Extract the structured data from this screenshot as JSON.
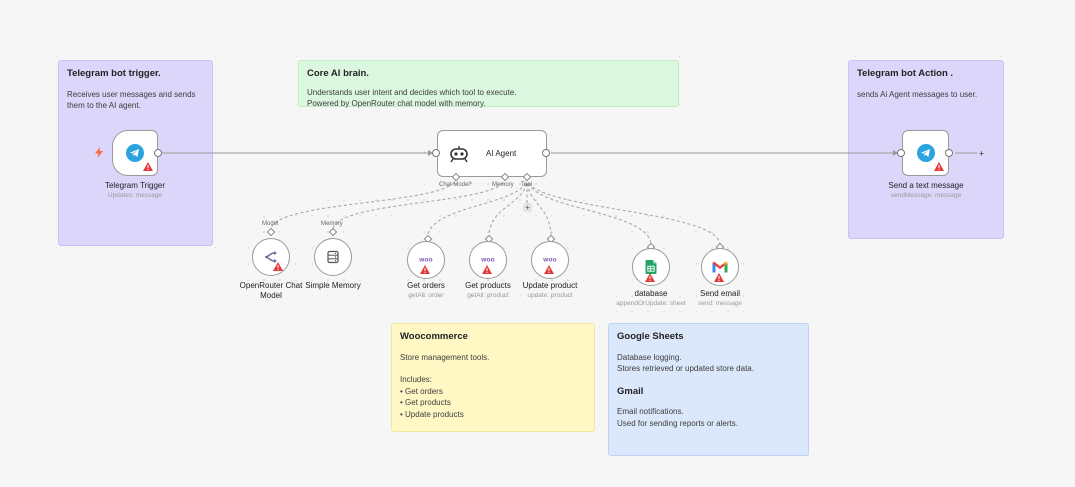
{
  "sticky_notes": {
    "telegram_trigger": {
      "title": "Telegram bot trigger.",
      "body": "Receives user messages and sends them to the AI agent."
    },
    "core_ai": {
      "title": "Core AI brain.",
      "line1": "Understands user intent and decides which tool to execute.",
      "line2": "Powered by OpenRouter chat model with memory."
    },
    "telegram_action": {
      "title": "Telegram bot Action .",
      "body": "sends Ai Agent messages to user."
    },
    "woocommerce": {
      "title": "Woocommerce",
      "line1": "Store management tools.",
      "line2": "Includes:",
      "items": [
        "• Get orders",
        "• Get products",
        "• Update products"
      ]
    },
    "google_sheets": {
      "title": "Google Sheets",
      "line1": "Database logging.",
      "line2": "Stores retrieved or updated store data.",
      "gmail_title": "Gmail",
      "gmail_line1": "Email notifications.",
      "gmail_line2": "Used for sending reports or alerts."
    }
  },
  "nodes": {
    "telegram_trigger": {
      "label": "Telegram Trigger",
      "sub": "Updates: message"
    },
    "ai_agent": {
      "label": "AI Agent",
      "port_chat_model": "Chat Model*",
      "port_memory": "Memory",
      "port_tool": "Tool"
    },
    "send_text": {
      "label": "Send a text message",
      "sub": "sendMessage: message"
    },
    "openrouter": {
      "label": "OpenRouter Chat Model",
      "port_label": "Model"
    },
    "simple_memory": {
      "label": "Simple Memory",
      "port_label": "Memory"
    },
    "get_orders": {
      "label": "Get orders",
      "sub": "getAll: order",
      "logo": "woo"
    },
    "get_products": {
      "label": "Get products",
      "sub": "getAll: product",
      "logo": "woo"
    },
    "update_product": {
      "label": "Update product",
      "sub": "update: product",
      "logo": "woo"
    },
    "database": {
      "label": "database",
      "sub": "appendOrUpdate: sheet"
    },
    "send_email": {
      "label": "Send email",
      "sub": "send: message"
    }
  },
  "icons": {
    "bolt": "lightning-bolt-icon",
    "telegram": "telegram-icon",
    "robot": "robot-icon",
    "openrouter": "openrouter-icon",
    "memory": "database-stack-icon",
    "sheets": "google-sheets-icon",
    "gmail": "gmail-icon",
    "warning": "warning-icon",
    "plus": "plus-icon"
  },
  "colors": {
    "telegram_blue": "#2aa3df",
    "warning_red": "#e23a3a",
    "bolt_orange": "#ff6d3a",
    "woo_purple": "#7f54b3",
    "sheets_green": "#21a464"
  }
}
